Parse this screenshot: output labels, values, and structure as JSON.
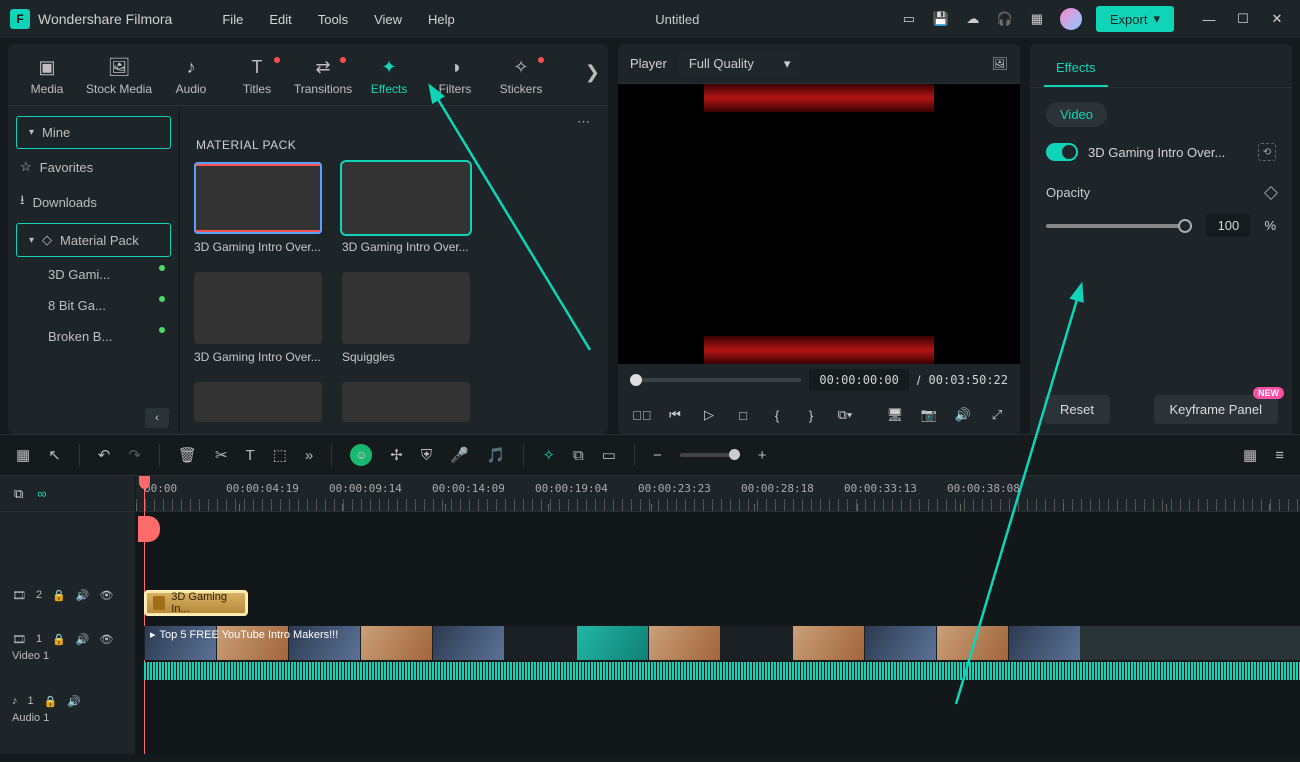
{
  "app": {
    "name": "Wondershare Filmora",
    "document": "Untitled"
  },
  "menu": [
    "File",
    "Edit",
    "Tools",
    "View",
    "Help"
  ],
  "export_label": "Export",
  "media_tabs": [
    {
      "label": "Media"
    },
    {
      "label": "Stock Media"
    },
    {
      "label": "Audio"
    },
    {
      "label": "Titles",
      "dot": "red"
    },
    {
      "label": "Transitions",
      "dot": "red"
    },
    {
      "label": "Effects",
      "active": true
    },
    {
      "label": "Filters"
    },
    {
      "label": "Stickers",
      "dot": "red"
    }
  ],
  "sidebar": {
    "mine": "Mine",
    "favorites": "Favorites",
    "downloads": "Downloads",
    "material_pack": "Material Pack",
    "subs": [
      {
        "label": "3D Gami..."
      },
      {
        "label": "8 Bit Ga..."
      },
      {
        "label": "Broken B..."
      }
    ]
  },
  "gallery": {
    "heading": "MATERIAL PACK",
    "items": [
      {
        "label": "3D Gaming Intro Over..."
      },
      {
        "label": "3D Gaming Intro Over..."
      },
      {
        "label": "3D Gaming Intro Over..."
      },
      {
        "label": "Squiggles"
      }
    ]
  },
  "preview": {
    "player_label": "Player",
    "quality": "Full Quality",
    "current": "00:00:00:00",
    "sep": "/",
    "duration": "00:03:50:22"
  },
  "effects": {
    "tab": "Effects",
    "chip": "Video",
    "name": "3D Gaming Intro Over...",
    "opacity_label": "Opacity",
    "opacity_value": "100",
    "opacity_unit": "%",
    "reset": "Reset",
    "keyframe": "Keyframe Panel",
    "new_badge": "NEW"
  },
  "ruler": [
    "00:00",
    "00:00:04:19",
    "00:00:09:14",
    "00:00:14:09",
    "00:00:19:04",
    "00:00:23:23",
    "00:00:28:18",
    "00:00:33:13",
    "00:00:38:08"
  ],
  "tracks": {
    "fx": {
      "icon": "🎞",
      "num": "2",
      "label": ""
    },
    "v1": {
      "icon": "🎞",
      "num": "1",
      "label": "Video 1"
    },
    "a1": {
      "icon": "♪",
      "num": "1",
      "label": "Audio 1"
    }
  },
  "clips": {
    "fx_label": "3D Gaming In...",
    "video_label": "Top 5 FREE YouTube Intro Makers!!!"
  }
}
